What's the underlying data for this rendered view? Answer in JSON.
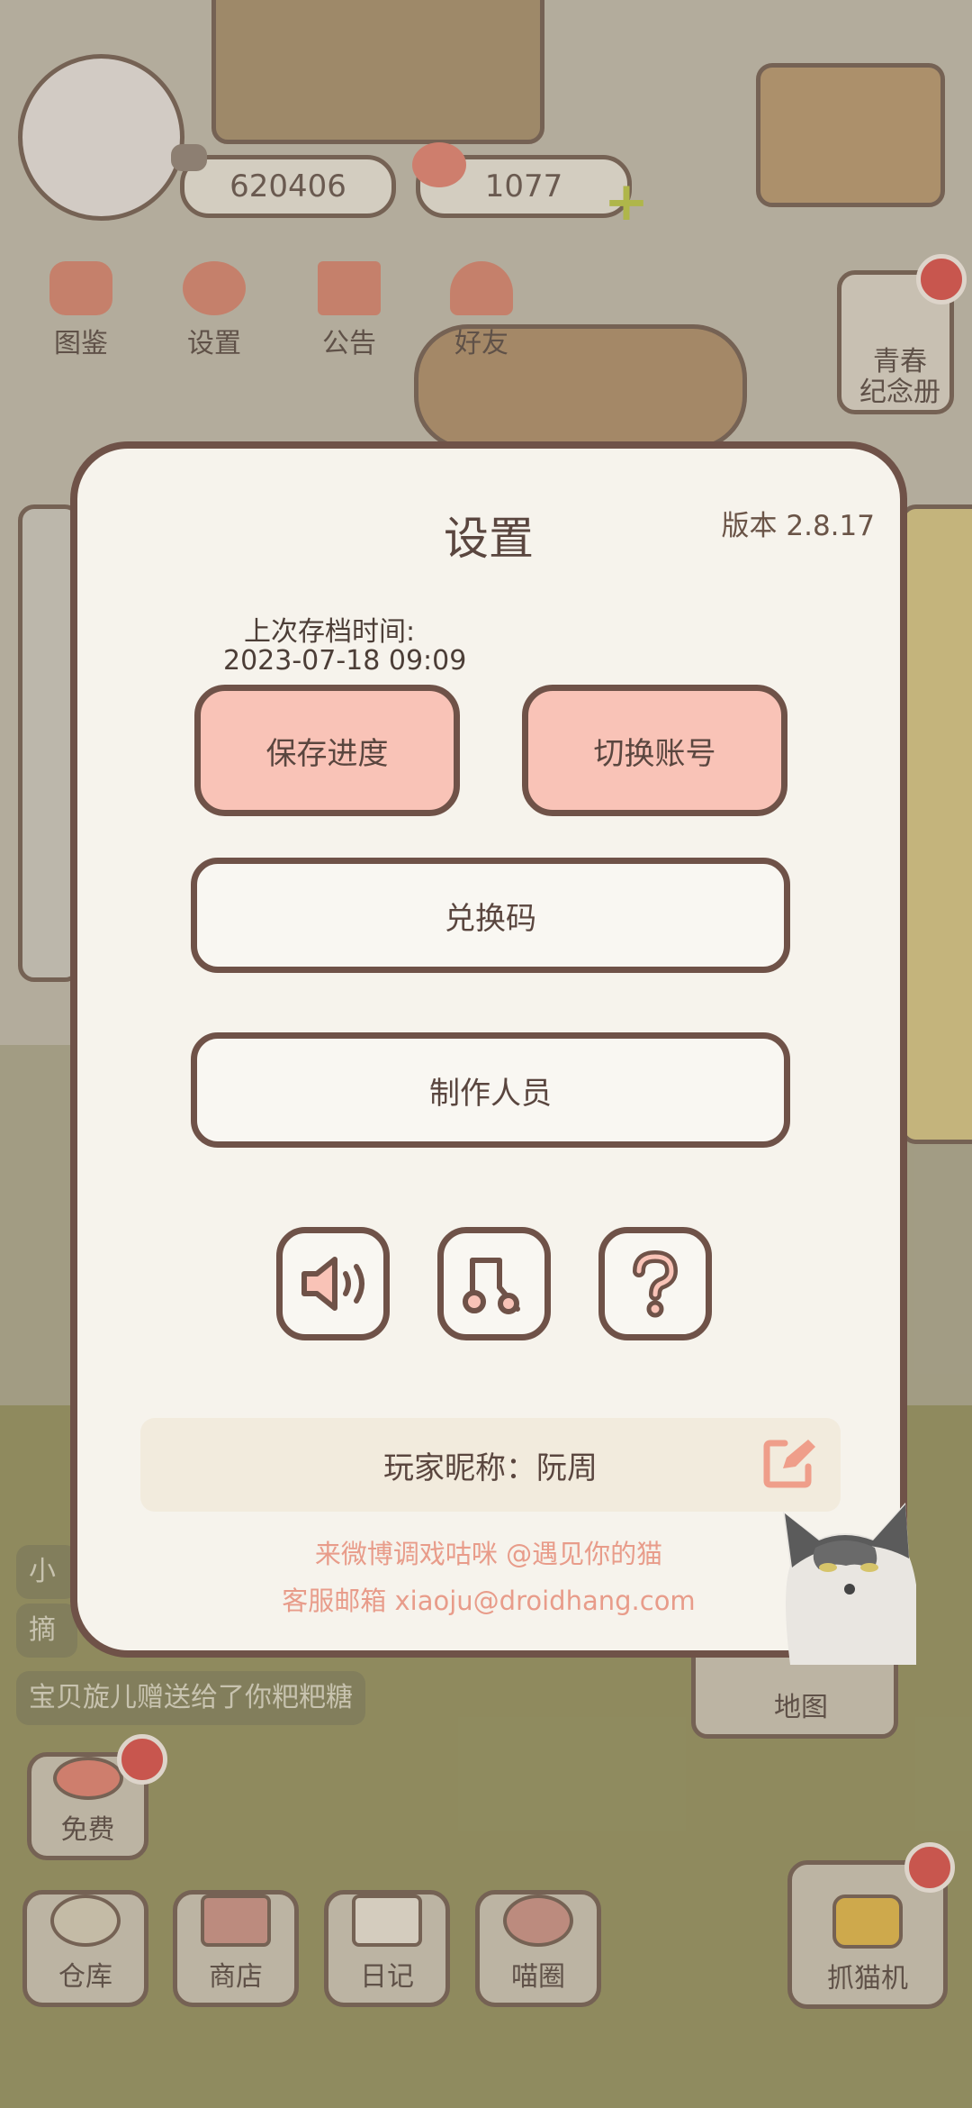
{
  "header": {
    "coins": "620406",
    "hearts": "1077"
  },
  "top_nav": [
    {
      "label": "图鉴"
    },
    {
      "label": "设置"
    },
    {
      "label": "公告"
    },
    {
      "label": "好友"
    }
  ],
  "memorial_book_label": "青春\n纪念册",
  "map_label": "地图",
  "chat_messages": [
    "小",
    "摘",
    "宝贝旋儿赠送给了你粑粑糖"
  ],
  "free_label": "免费",
  "bottom_nav": [
    {
      "label": "仓库"
    },
    {
      "label": "商店"
    },
    {
      "label": "日记"
    },
    {
      "label": "喵圈"
    }
  ],
  "claw_machine_label": "抓猫机",
  "settings_dialog": {
    "title": "设置",
    "version": "版本 2.8.17",
    "last_save_label": "上次存档时间:",
    "last_save_time": "2023-07-18 09:09",
    "save_progress_button": "保存进度",
    "switch_account_button": "切换账号",
    "redeem_code_button": "兑换码",
    "credits_button": "制作人员",
    "nickname": "玩家昵称：阮周",
    "weibo_text": "来微博调戏咕咪 @遇见你的猫",
    "email_text": "客服邮箱 xiaoju@droidhang.com"
  },
  "colors": {
    "dialog_bg": "#f6f3ec",
    "dialog_border": "#6f5248",
    "pink_button": "#f9c3b7",
    "pink_text": "#e89c8a",
    "red_badge": "#d8453f"
  },
  "icons": [
    "sound-icon",
    "music-icon",
    "help-icon",
    "edit-icon"
  ]
}
